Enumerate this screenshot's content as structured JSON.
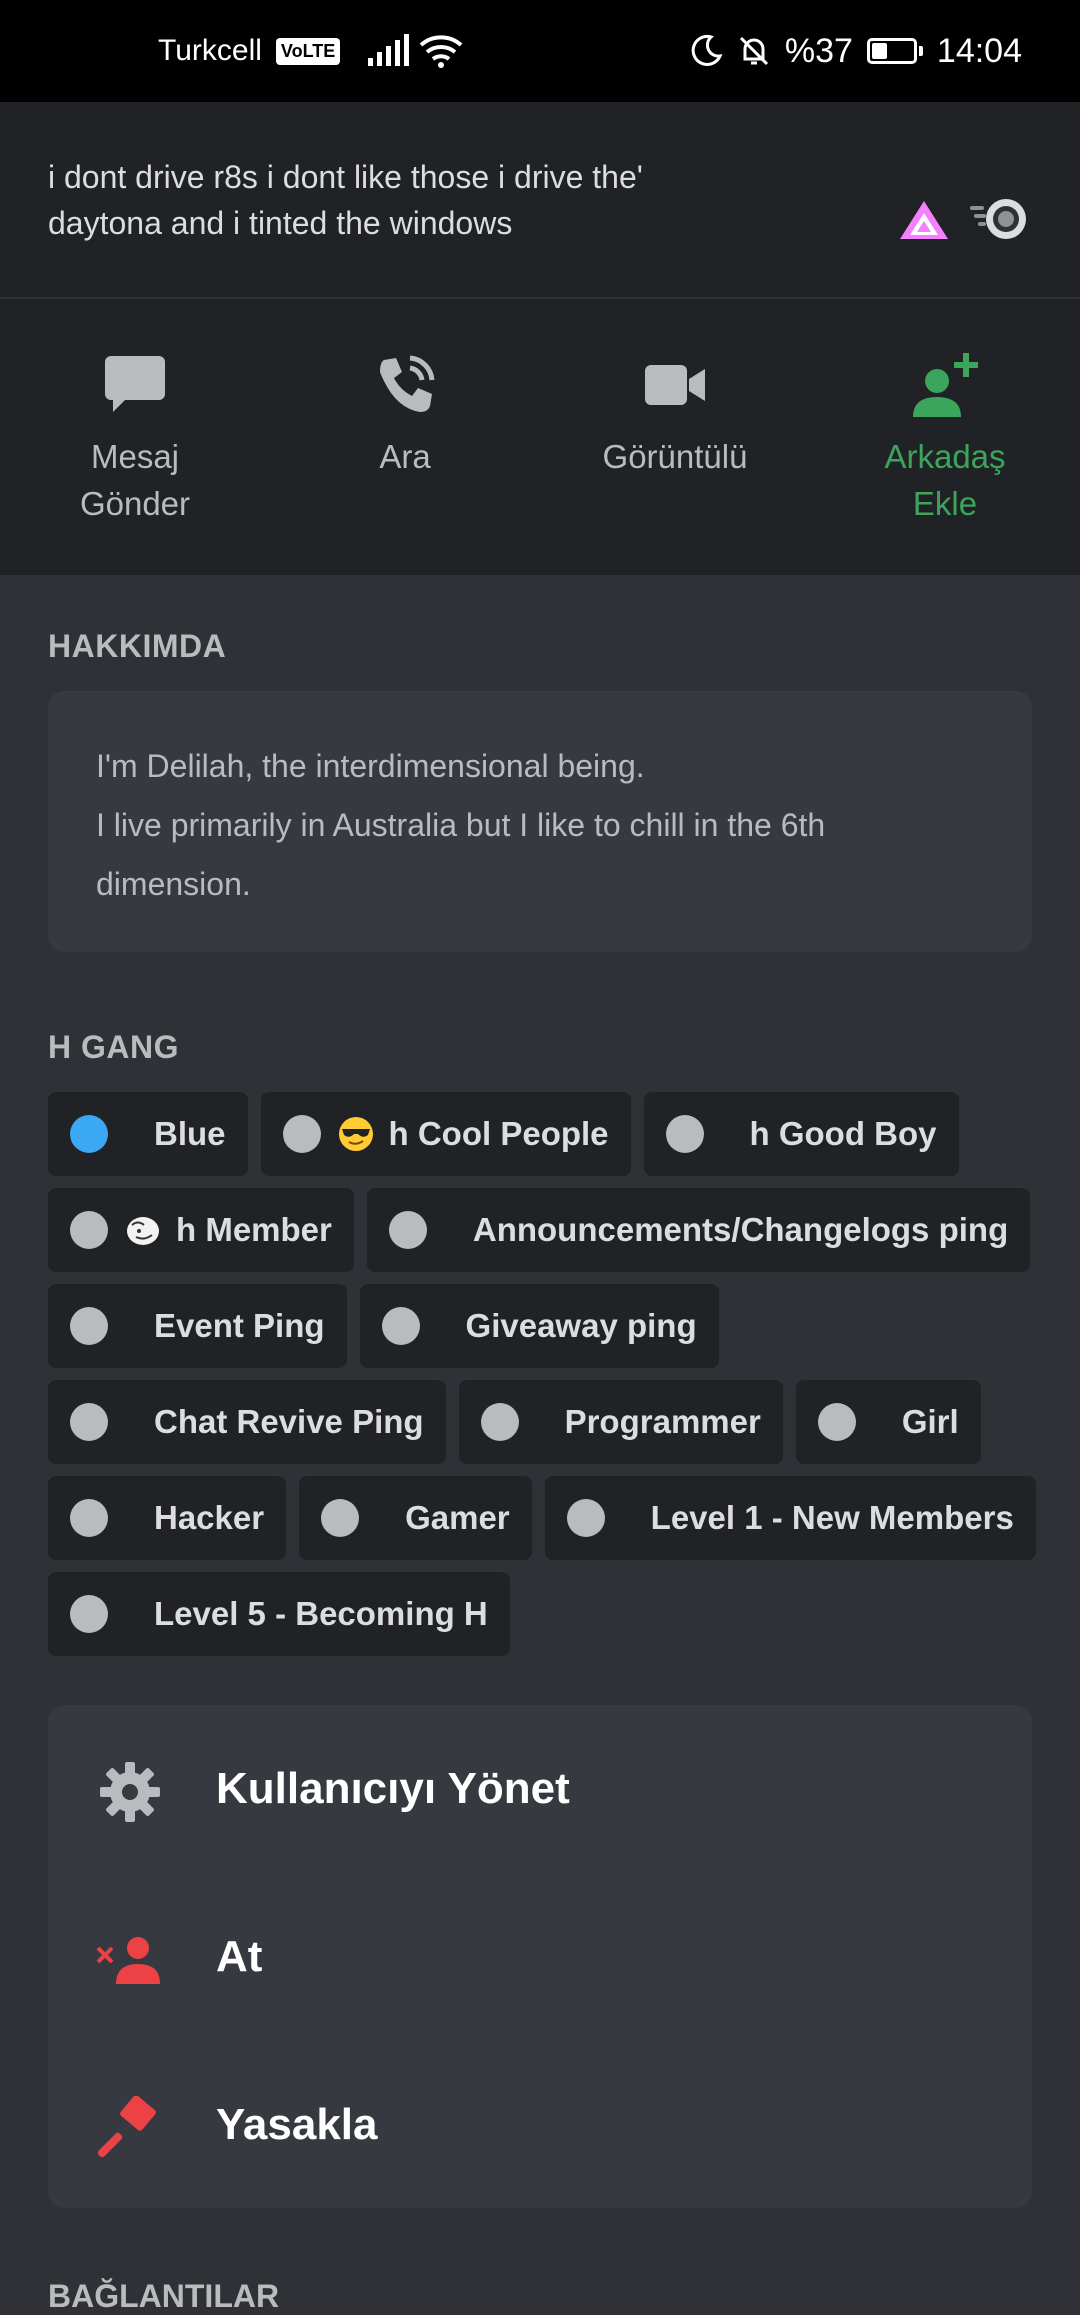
{
  "status_bar": {
    "carrier": "Turkcell",
    "volte": "VoLTE",
    "battery_percent": "%37",
    "battery_level": 0.37,
    "time": "14:04"
  },
  "custom_status": {
    "text": "i dont drive r8s i dont like those i drive the' daytona and i tinted the windows"
  },
  "actions": {
    "message": "Mesaj Gönder",
    "call": "Ara",
    "video": "Görüntülü",
    "add_friend": "Arkadaş Ekle"
  },
  "about": {
    "heading": "HAKKIMDA",
    "line1": "I'm Delilah, the interdimensional being.",
    "line2": "I live primarily in Australia but I like to chill in the 6th dimension."
  },
  "roles": {
    "heading": "H GANG",
    "items": [
      {
        "label": "Blue",
        "color": "#3ba8f5"
      },
      {
        "label": "h Cool People",
        "color": "#b9bbbe",
        "emoji": "sunglasses"
      },
      {
        "label": "h Good Boy",
        "color": "#b9bbbe"
      },
      {
        "label": "h Member",
        "color": "#b9bbbe",
        "emoji": "ghost-face"
      },
      {
        "label": "Announcements/Changelogs ping",
        "color": "#b9bbbe"
      },
      {
        "label": "Event Ping",
        "color": "#b9bbbe"
      },
      {
        "label": "Giveaway ping",
        "color": "#b9bbbe"
      },
      {
        "label": "Chat Revive Ping",
        "color": "#b9bbbe"
      },
      {
        "label": "Programmer",
        "color": "#b9bbbe"
      },
      {
        "label": "Girl",
        "color": "#b9bbbe"
      },
      {
        "label": "Hacker",
        "color": "#b9bbbe"
      },
      {
        "label": "Gamer",
        "color": "#b9bbbe"
      },
      {
        "label": "Level 1 - New Members",
        "color": "#b9bbbe"
      },
      {
        "label": "Level 5 - Becoming H",
        "color": "#b9bbbe"
      }
    ]
  },
  "moderation": {
    "manage_user": "Kullanıcıyı Yönet",
    "kick": "At",
    "ban": "Yasakla"
  },
  "connections_heading": "BAĞLANTILAR",
  "colors": {
    "background": "#2f3136",
    "header_bg": "#202225",
    "card_bg": "#36393f",
    "accent_green": "#3ba55c",
    "danger_red": "#ed4245"
  }
}
